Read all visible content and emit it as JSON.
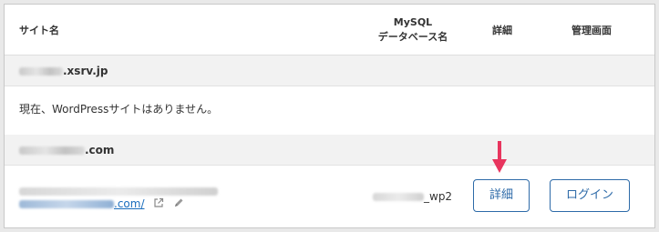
{
  "table": {
    "headers": {
      "site_name": "サイト名",
      "db_line1": "MySQL",
      "db_line2": "データベース名",
      "detail": "詳細",
      "admin": "管理画面"
    }
  },
  "domains": [
    {
      "name_suffix": ".xsrv.jp",
      "empty_message": "現在、WordPressサイトはありません。"
    },
    {
      "name_suffix": ".com",
      "site": {
        "url_suffix": ".com/",
        "db_name_suffix": "_wp2",
        "detail_button": "詳細",
        "login_button": "ログイン"
      }
    }
  ],
  "icons": {
    "external_link": "external-link-icon",
    "edit": "pencil-icon",
    "annotation": "down-arrow-annotation"
  },
  "colors": {
    "accent": "#2d6aa8",
    "link": "#1a6dbd",
    "annotation_arrow": "#e8355e",
    "row_header_bg": "#f2f2f2"
  }
}
